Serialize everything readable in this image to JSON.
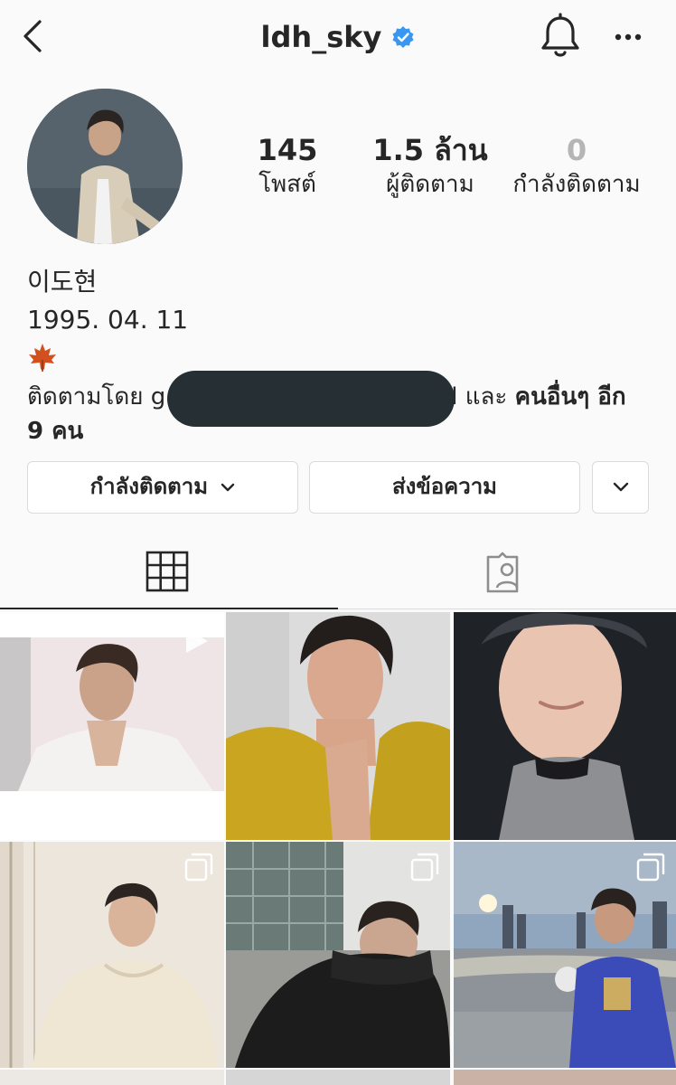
{
  "header": {
    "username": "ldh_sky",
    "back_icon": "chevron-left-icon",
    "verified_icon": "verified-badge-icon",
    "bell_icon": "bell-icon",
    "more_icon": "more-horizontal-icon"
  },
  "stats": {
    "posts": {
      "value": "145",
      "label": "โพสต์"
    },
    "followers": {
      "value": "1.5 ล้าน",
      "label": "ผู้ติดตาม"
    },
    "following": {
      "value": "0",
      "label": "กำลังติดตาม"
    }
  },
  "bio": {
    "name": "이도현",
    "birthdate": "1995. 04. 11",
    "emoji": "maple-leaf-icon",
    "followed_by_prefix": "ติดตามโดย g",
    "followed_by_suffix_start": "l และ ",
    "followed_by_bold": "คนอื่นๆ อีก",
    "followed_by_count": "9 คน"
  },
  "actions": {
    "following_label": "กำลังติดตาม",
    "message_label": "ส่งข้อความ"
  },
  "tabs": [
    {
      "name": "posts-grid",
      "icon": "grid-icon",
      "active": true
    },
    {
      "name": "tagged",
      "icon": "tagged-user-icon",
      "active": false
    }
  ],
  "posts": [
    {
      "badge": "video-icon"
    },
    {
      "badge": null
    },
    {
      "badge": null
    },
    {
      "badge": "carousel-icon"
    },
    {
      "badge": "carousel-icon"
    },
    {
      "badge": "carousel-icon"
    }
  ],
  "colors": {
    "accent": "#3897f0",
    "text": "#262626",
    "muted": "#b5b5b5",
    "border": "#dbdbdb",
    "background": "#fafafa"
  }
}
